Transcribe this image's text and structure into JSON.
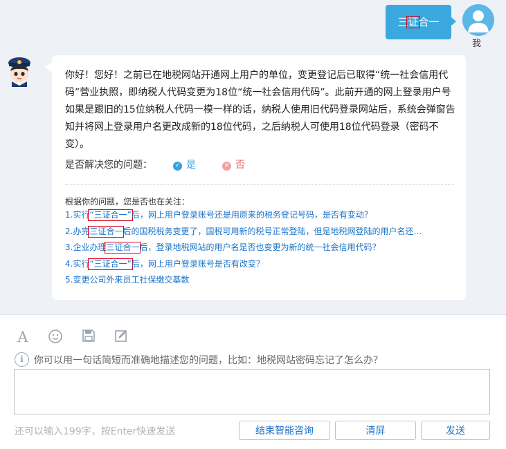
{
  "user": {
    "message_pre": "三",
    "message_marked": "证",
    "message_post": "合一",
    "name": "我"
  },
  "bot": {
    "answer": "你好！您好！之前已在地税网站开通网上用户的单位，变更登记后已取得“统一社会信用代码”营业执照，即纳税人代码变更为18位“统一社会信用代码”。此前开通的网上登录用户号如果是跟旧的15位纳税人代码一模一样的话，纳税人使用旧代码登录网站后，系统会弹窗告知并将网上登录用户名更改成新的18位代码，之后纳税人可使用18位代码登录（密码不变）。",
    "resolve_label": "是否解决您的问题：",
    "yes_label": "是",
    "no_label": "否",
    "related_title": "根据你的问题，您是否也在关注：",
    "related": [
      {
        "pre": "1.实行",
        "mark": "“三证合一”",
        "post": "后，网上用户登录账号还是用原来的税务登记号码，是否有变动？"
      },
      {
        "pre": "2.办完",
        "mark": "三证合一",
        "post": "后的国税税务变更了，国税可用新的税号正常登陆，但是地税网登陆的用户名还…"
      },
      {
        "pre": "3.企业办理",
        "mark": "三证合一",
        "post": "后，登录地税网站的用户名是否也变更为新的统一社会信用代码？"
      },
      {
        "pre": "4.实行",
        "mark": "“三证合一”",
        "post": "后，网上用户登录账号是否有改变？"
      },
      {
        "pre": "5.变更公司外来员工社保缴交基数",
        "mark": "",
        "post": ""
      }
    ]
  },
  "editor": {
    "hint": "你可以用一句话简短而准确地描述您的问题，比如：地税网站密码忘记了怎么办？",
    "input_value": "",
    "counter": "还可以输入199字，按Enter快速发送",
    "end_button": "结束智能咨询",
    "clear_button": "清屏",
    "send_button": "发送"
  }
}
